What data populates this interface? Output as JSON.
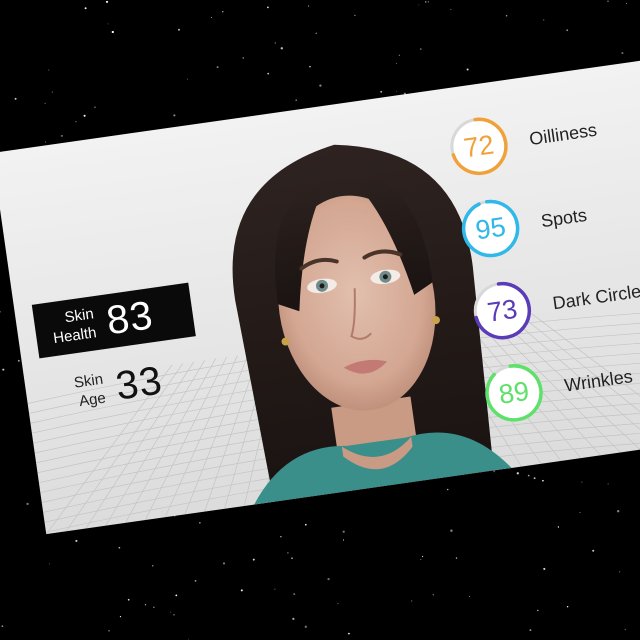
{
  "summary": {
    "skin_health": {
      "label_line1": "Skin",
      "label_line2": "Health",
      "value": "83"
    },
    "skin_age": {
      "label_line1": "Skin",
      "label_line2": "Age",
      "value": "33"
    }
  },
  "metrics": [
    {
      "label": "Oilliness",
      "value": "72",
      "score": 72,
      "color": "#f0a13a"
    },
    {
      "label": "Spots",
      "value": "95",
      "score": 95,
      "color": "#2fb8e8"
    },
    {
      "label": "Dark Circle",
      "value": "73",
      "score": 73,
      "color": "#5a3bb8"
    },
    {
      "label": "Wrinkles",
      "value": "89",
      "score": 89,
      "color": "#5ee06a"
    }
  ]
}
